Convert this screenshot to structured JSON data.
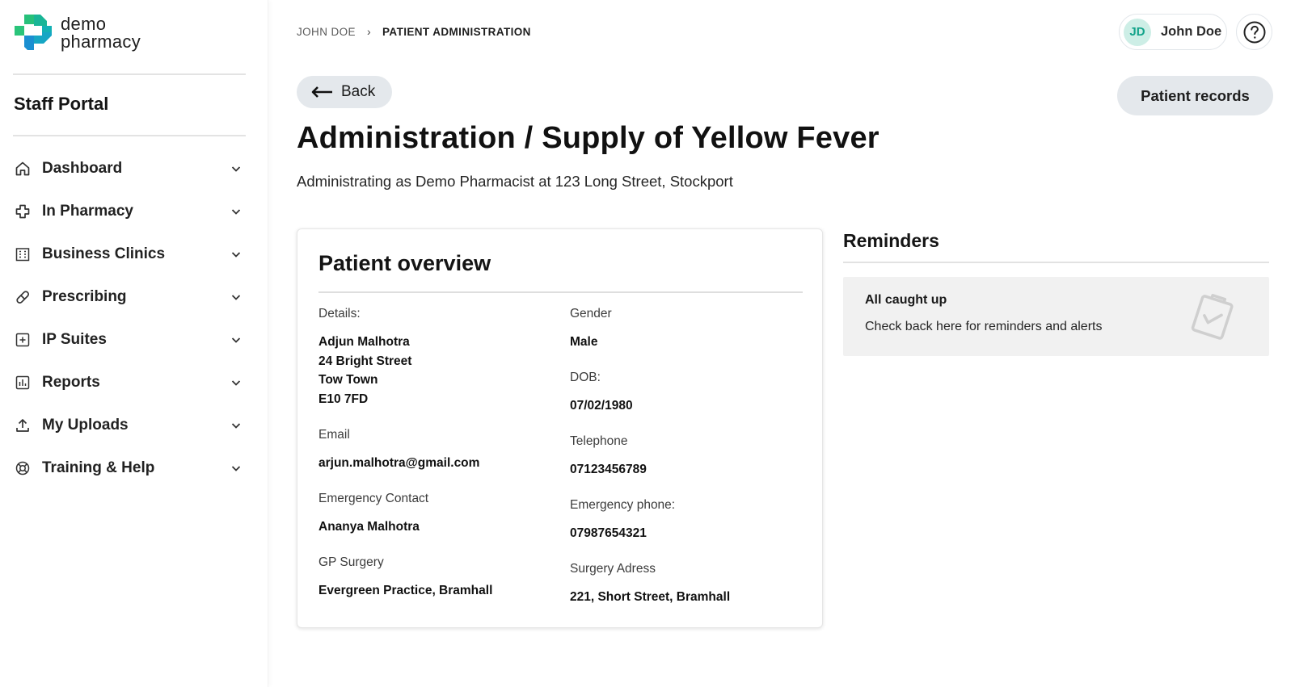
{
  "brand": {
    "line1": "demo",
    "line2": "pharmacy",
    "colors": {
      "green": "#27c07a",
      "teal": "#13b1b4",
      "blue": "#1a8fd1"
    }
  },
  "sidebar": {
    "portal_title": "Staff Portal",
    "items": [
      {
        "label": "Dashboard",
        "icon": "home-icon"
      },
      {
        "label": "In Pharmacy",
        "icon": "medical-cross-icon"
      },
      {
        "label": "Business Clinics",
        "icon": "building-icon"
      },
      {
        "label": "Prescribing",
        "icon": "pill-icon"
      },
      {
        "label": "IP Suites",
        "icon": "plus-square-icon"
      },
      {
        "label": "Reports",
        "icon": "bar-chart-icon"
      },
      {
        "label": "My Uploads",
        "icon": "upload-icon"
      },
      {
        "label": "Training & Help",
        "icon": "lifebuoy-icon"
      }
    ]
  },
  "breadcrumb": {
    "items": [
      "JOHN DOE",
      "PATIENT ADMINISTRATION"
    ],
    "separator": "›"
  },
  "user": {
    "initials": "JD",
    "name": "John Doe"
  },
  "help": {
    "icon": "question-icon"
  },
  "actions": {
    "back_label": "Back",
    "records_label": "Patient records"
  },
  "page": {
    "title": "Administration / Supply of Yellow Fever",
    "subtitle": "Administrating as Demo Pharmacist at 123 Long Street, Stockport"
  },
  "patient": {
    "card_title": "Patient overview",
    "details_label": "Details:",
    "details_lines": [
      "Adjun Malhotra",
      "24 Bright Street",
      "Tow Town",
      "E10 7FD"
    ],
    "gender_label": "Gender",
    "gender": "Male",
    "dob_label": "DOB:",
    "dob": "07/02/1980",
    "email_label": "Email",
    "email": "arjun.malhotra@gmail.com",
    "telephone_label": "Telephone",
    "telephone": "07123456789",
    "emergency_contact_label": "Emergency Contact",
    "emergency_contact": "Ananya Malhotra",
    "emergency_phone_label": "Emergency phone:",
    "emergency_phone": "07987654321",
    "gp_label": "GP Surgery",
    "gp": "Evergreen Practice, Bramhall",
    "surgery_address_label": "Surgery Adress",
    "surgery_address": "221, Short Street, Bramhall"
  },
  "reminders": {
    "title": "Reminders",
    "heading": "All caught up",
    "text": "Check back here for reminders and alerts",
    "icon": "clipboard-check-icon"
  }
}
